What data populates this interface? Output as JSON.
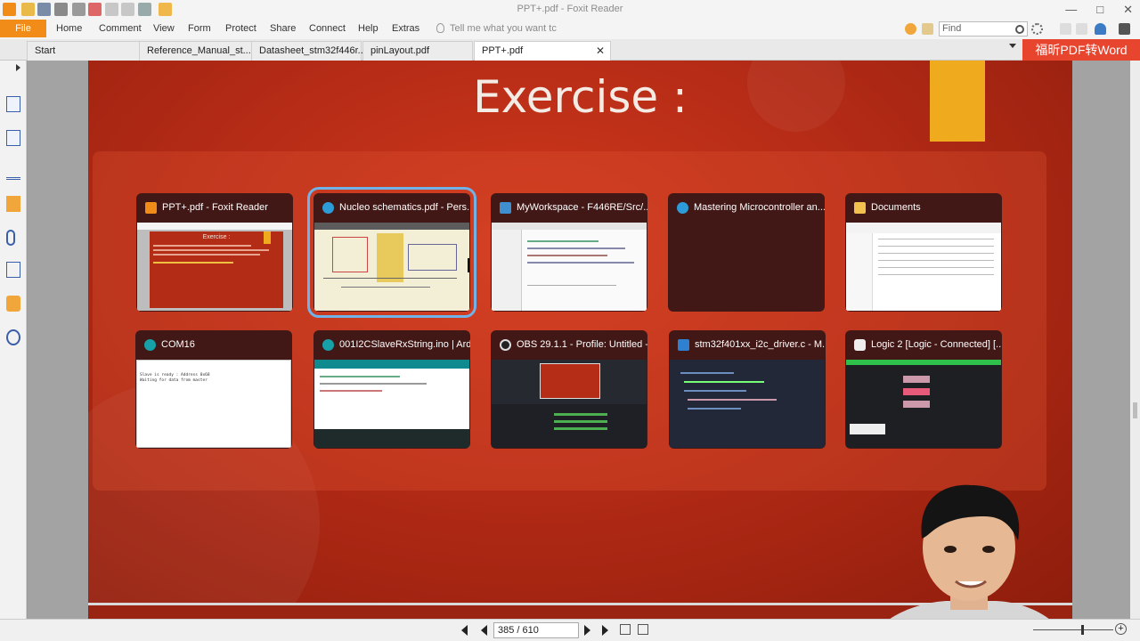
{
  "app": {
    "title": "PPT+.pdf - Foxit Reader"
  },
  "menu": {
    "file": "File",
    "items": [
      "Home",
      "Comment",
      "View",
      "Form",
      "Protect",
      "Share",
      "Connect",
      "Help",
      "Extras"
    ],
    "tell_me": "Tell me what you want tc",
    "find_placeholder": "Find"
  },
  "tabs": [
    {
      "label": "Start"
    },
    {
      "label": "Reference_Manual_st..."
    },
    {
      "label": "Datasheet_stm32f446r..."
    },
    {
      "label": "pinLayout.pdf"
    },
    {
      "label": "PPT+.pdf",
      "active": true
    }
  ],
  "convert_button": "福昕PDF转Word",
  "slide": {
    "title": "Exercise :"
  },
  "task_view": {
    "windows": [
      {
        "title": "PPT+.pdf - Foxit Reader",
        "icon": "foxit-icon",
        "color": "#f08c17"
      },
      {
        "title": "Nucleo schematics.pdf - Pers...",
        "icon": "edge-icon",
        "color": "#2d9bd8",
        "selected": true
      },
      {
        "title": "MyWorkspace - F446RE/Src/...",
        "icon": "ide-icon",
        "color": "#3e8ed0"
      },
      {
        "title": "Mastering Microcontroller an...",
        "icon": "edge-icon",
        "color": "#2d9bd8"
      },
      {
        "title": "Documents",
        "icon": "folder-icon",
        "color": "#f2c14e"
      },
      {
        "title": "COM16",
        "icon": "arduino-icon",
        "color": "#16a1a8"
      },
      {
        "title": "001I2CSlaveRxString.ino | Ard...",
        "icon": "arduino-icon",
        "color": "#16a1a8"
      },
      {
        "title": "OBS 29.1.1 - Profile: Untitled -...",
        "icon": "obs-icon",
        "color": "#dddddd"
      },
      {
        "title": "stm32f401xx_i2c_driver.c - M...",
        "icon": "vscode-icon",
        "color": "#2f80d0"
      },
      {
        "title": "Logic 2 [Logic - Connected] [...",
        "icon": "logic-icon",
        "color": "#eeeeee"
      }
    ]
  },
  "thumbs": {
    "ppt_title": "Exercise :",
    "com16_lines": [
      "Slave is ready : Address 0x68",
      "Waiting for data from master"
    ]
  },
  "status": {
    "page": "385 / 610"
  }
}
